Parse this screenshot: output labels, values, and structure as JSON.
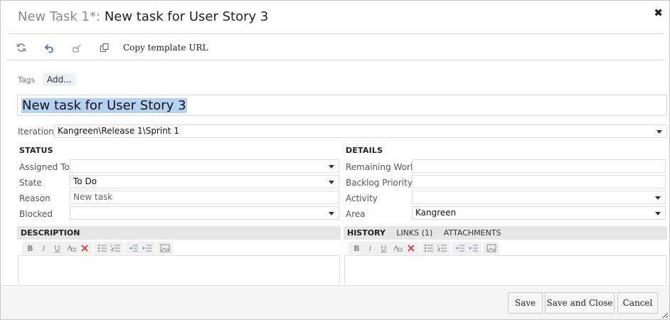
{
  "dialog": {
    "title_prefix": "New Task 1*:",
    "title_name": "New task for User Story 3"
  },
  "toolbar": {
    "refresh_icon": "refresh-icon",
    "undo_icon": "undo-icon",
    "edit_icon": "edit-icon",
    "copy_icon": "copy-icon",
    "copy_template_label": "Copy template URL"
  },
  "tags": {
    "label": "Tags",
    "add_label": "Add..."
  },
  "task": {
    "title": "New task for User Story 3"
  },
  "iteration": {
    "label": "Iteration",
    "value": "Kangreen\\Release 1\\Sprint 1"
  },
  "status": {
    "heading": "STATUS",
    "assigned_to_label": "Assigned To",
    "assigned_to_value": "",
    "state_label": "State",
    "state_value": "To Do",
    "reason_label": "Reason",
    "reason_value": "New task",
    "blocked_label": "Blocked",
    "blocked_value": ""
  },
  "details": {
    "heading": "DETAILS",
    "remaining_work_label": "Remaining Work",
    "remaining_work_value": "",
    "backlog_priority_label": "Backlog Priority",
    "backlog_priority_value": "",
    "activity_label": "Activity",
    "activity_value": "",
    "area_label": "Area",
    "area_value": "Kangreen"
  },
  "description": {
    "heading": "DESCRIPTION"
  },
  "right_tabs": {
    "history": "HISTORY",
    "links": "LINKS (1)",
    "attachments": "ATTACHMENTS"
  },
  "rte": {
    "bold": "B",
    "italic": "I",
    "underline": "U"
  },
  "footer": {
    "save": "Save",
    "save_and_close": "Save and Close",
    "cancel": "Cancel"
  },
  "colors": {
    "selection": "#b5d2f3",
    "pane_header": "#e6e6e6",
    "footer_bg": "#f5f5f5"
  }
}
